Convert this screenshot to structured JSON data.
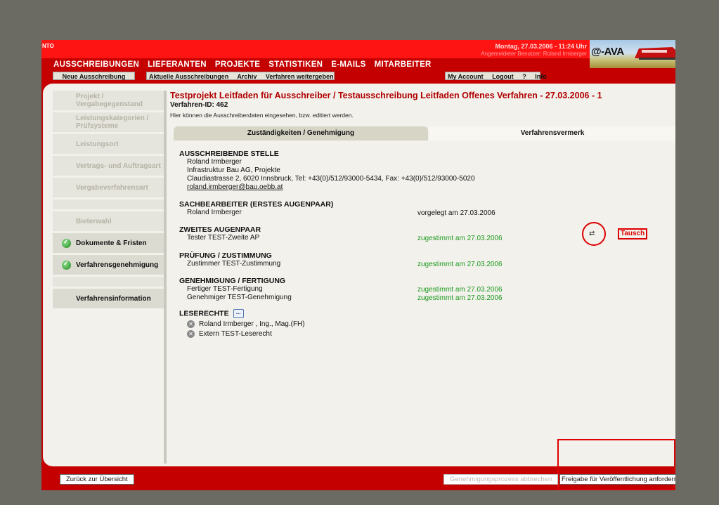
{
  "header": {
    "logo_left": "NTO",
    "date_time": "Montag, 27.03.2006 - 11:24 Uhr",
    "user_info": "Angemeldeter Benutzer: Roland Irmberger",
    "app_logo": "@-AVA"
  },
  "main_nav": [
    "AUSSCHREIBUNGEN",
    "LIEFERANTEN",
    "PROJEKTE",
    "STATISTIKEN",
    "E-MAILS",
    "MITARBEITER"
  ],
  "sub_nav": {
    "new": "Neue Ausschreibung",
    "items": [
      "Aktuelle Ausschreibungen",
      "Archiv",
      "Verfahren weitergeben"
    ],
    "right_items": [
      "My Account",
      "Logout",
      "?",
      "Info"
    ]
  },
  "sidebar": [
    {
      "label": "Projekt / Vergabegegenstand",
      "state": "disabled"
    },
    {
      "label": "Leistungskategorien / Prüfsysteme",
      "state": "disabled"
    },
    {
      "label": "Leistungsort",
      "state": "disabled"
    },
    {
      "label": "Vertrags- und Auftragsart",
      "state": "disabled"
    },
    {
      "label": "Vergabeverfahrensart",
      "state": "disabled"
    },
    {
      "label": "",
      "state": "empty"
    },
    {
      "label": "Bieterwahl",
      "state": "disabled"
    },
    {
      "label": "Dokumente & Fristen",
      "state": "ok"
    },
    {
      "label": "Verfahrensgenehmigung",
      "state": "ok"
    },
    {
      "label": "",
      "state": "empty"
    },
    {
      "label": "Verfahrensinformation",
      "state": "active"
    }
  ],
  "page": {
    "title": "Testprojekt Leitfaden für Ausschreiber / Testausschreibung Leitfaden Offenes Verfahren - 27.03.2006 - 1",
    "verfahren_id": "Verfahren-ID: 462",
    "hint": "Hier können die Ausschreiberdaten eingesehen, bzw. editiert werden."
  },
  "tabs": [
    "Zuständigkeiten / Genehmigung",
    "Verfahrensvermerk"
  ],
  "sections": {
    "ausschreibende_stelle": {
      "heading": "AUSSCHREIBENDE STELLE",
      "name": "Roland Irmberger",
      "org": "Infrastruktur Bau AG, Projekte",
      "address": "Claudiastrasse 2, 6020 Innsbruck, Tel: +43(0)/512/93000-5434, Fax: +43(0)/512/93000-5020",
      "email": "roland.irmberger@bau.oebb.at"
    },
    "sachbearbeiter": {
      "heading": "SACHBEARBEITER (ERSTES AUGENPAAR)",
      "name": "Roland Irmberger",
      "status": "vorgelegt am 27.03.2006"
    },
    "zweites_augenpaar": {
      "heading": "ZWEITES AUGENPAAR",
      "name": "Tester TEST-Zweite AP",
      "status": "zugestimmt am 27.03.2006",
      "swap_label": "Tausch"
    },
    "pruefung": {
      "heading": "PRÜFUNG / ZUSTIMMUNG",
      "name": "Zustimmer TEST-Zustimmung",
      "status": "zugestimmt am 27.03.2006"
    },
    "genehmigung": {
      "heading": "GENEHMIGUNG / FERTIGUNG",
      "rows": [
        {
          "name": "Fertiger TEST-Fertigung",
          "status": "zugestimmt am 27.03.2006"
        },
        {
          "name": "Genehmiger TEST-Genehmigung",
          "status": "zugestimmt am 27.03.2006"
        }
      ]
    },
    "leserechte": {
      "heading": "LESERECHTE",
      "more": "...",
      "users": [
        "Roland Irmberger , Ing., Mag.(FH)",
        "Extern TEST-Leserecht"
      ]
    }
  },
  "footer": {
    "back": "Zurück zur Übersicht",
    "abort": "Genehmigungsprozess abbrechen",
    "release": "Freigabe für Veröffentlichung anfordern"
  }
}
